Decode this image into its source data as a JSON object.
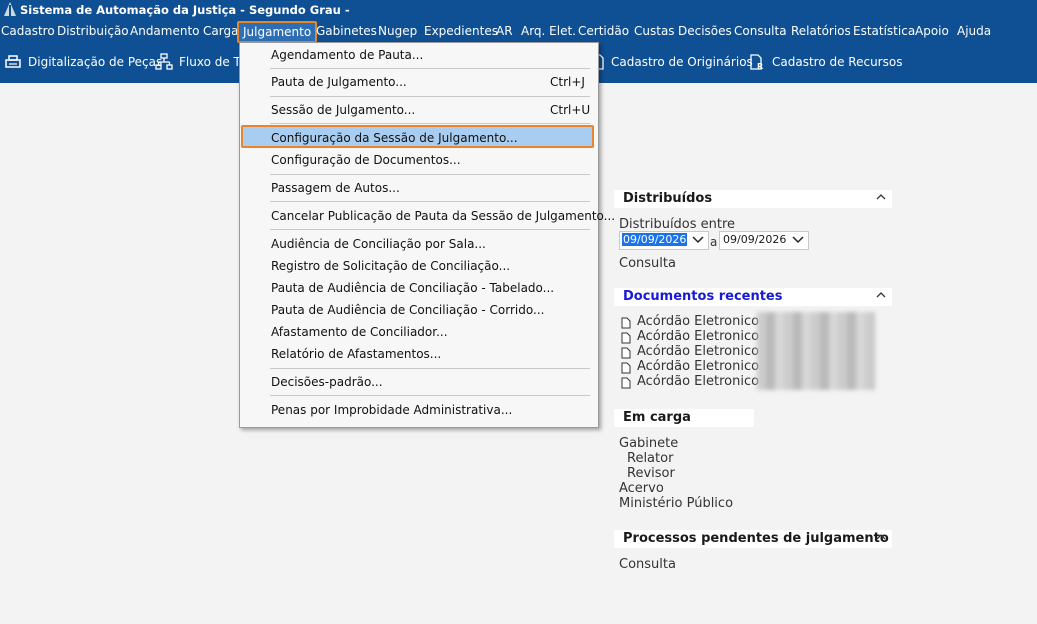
{
  "titlebar": {
    "title": "Sistema de Automação da Justiça - Segundo Grau -"
  },
  "menubar": {
    "items": [
      "Cadastro",
      "Distribuição",
      "Andamento",
      "Carga",
      "Julgamento",
      "Gabinetes",
      "Nugep",
      "Expedientes",
      "AR",
      "Arq. Elet.",
      "Certidão",
      "Custas",
      "Decisões",
      "Consulta",
      "Relatórios",
      "Estatística",
      "Apoio",
      "Ajuda"
    ],
    "active": "Julgamento"
  },
  "toolbar": {
    "digitalizacao": "Digitalização de Peças",
    "fluxo": "Fluxo de Tra",
    "cadastro_originarios": "Cadastro de Originários",
    "cadastro_recursos": "Cadastro de Recursos"
  },
  "dropdown": {
    "items": [
      {
        "label": "Agendamento de Pauta...",
        "shortcut": ""
      },
      {
        "label": "Pauta de Julgamento...",
        "shortcut": "Ctrl+J"
      },
      {
        "label": "Sessão de Julgamento...",
        "shortcut": "Ctrl+U"
      },
      {
        "label": "Configuração da Sessão de Julgamento...",
        "shortcut": ""
      },
      {
        "label": "Configuração de Documentos...",
        "shortcut": ""
      },
      {
        "label": "Passagem de Autos...",
        "shortcut": ""
      },
      {
        "label": "Cancelar Publicação de Pauta da Sessão de Julgamento...",
        "shortcut": ""
      },
      {
        "label": "Audiência de Conciliação por Sala...",
        "shortcut": ""
      },
      {
        "label": "Registro de Solicitação de Conciliação...",
        "shortcut": ""
      },
      {
        "label": "Pauta de Audiência de Conciliação - Tabelado...",
        "shortcut": ""
      },
      {
        "label": "Pauta de Audiência de Conciliação - Corrido...",
        "shortcut": ""
      },
      {
        "label": "Afastamento de Conciliador...",
        "shortcut": ""
      },
      {
        "label": "Relatório de Afastamentos...",
        "shortcut": ""
      },
      {
        "label": "Decisões-padrão...",
        "shortcut": ""
      },
      {
        "label": "Penas por Improbidade Administrativa...",
        "shortcut": ""
      }
    ],
    "highlighted": "Configuração da Sessão de Julgamento..."
  },
  "distribuidos": {
    "title": "Distribuídos",
    "label": "Distribuídos entre",
    "date_from": "09/09/2026",
    "separator": "a",
    "date_to": "09/09/2026",
    "consulta": "Consulta"
  },
  "documentos": {
    "title": "Documentos recentes",
    "items": [
      "Acórdão Eletronico",
      "Acórdão Eletronico",
      "Acórdão Eletronico",
      "Acórdão Eletronico",
      "Acórdão Eletronico"
    ]
  },
  "carga": {
    "title": "Em carga",
    "items": [
      "Gabinete",
      "Relator",
      "Revisor",
      "Acervo",
      "Ministério Público"
    ]
  },
  "pendentes": {
    "title": "Processos pendentes de julgamento",
    "consulta": "Consulta"
  },
  "colors": {
    "bar": "#0f4f93",
    "highlight": "#a8cdf0",
    "accent_border": "#e8842a",
    "link": "#1a1ad6"
  }
}
